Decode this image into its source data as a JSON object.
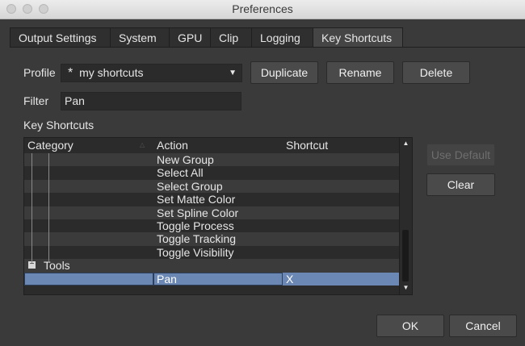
{
  "window": {
    "title": "Preferences"
  },
  "tabs": [
    {
      "label": "Output Settings"
    },
    {
      "label": "System"
    },
    {
      "label": "GPU"
    },
    {
      "label": "Clip"
    },
    {
      "label": "Logging"
    },
    {
      "label": "Key Shortcuts",
      "active": true
    }
  ],
  "profile": {
    "label": "Profile",
    "star": "*",
    "value": "my shortcuts",
    "buttons": {
      "duplicate": "Duplicate",
      "rename": "Rename",
      "delete": "Delete"
    }
  },
  "filter": {
    "label": "Filter",
    "value": "Pan"
  },
  "shortcuts": {
    "section_label": "Key Shortcuts",
    "columns": {
      "category": "Category",
      "action": "Action",
      "shortcut": "Shortcut"
    },
    "rows": [
      {
        "category": "",
        "action": "New Group",
        "shortcut": ""
      },
      {
        "category": "",
        "action": "Select All",
        "shortcut": ""
      },
      {
        "category": "",
        "action": "Select Group",
        "shortcut": ""
      },
      {
        "category": "",
        "action": "Set Matte Color",
        "shortcut": ""
      },
      {
        "category": "",
        "action": "Set Spline Color",
        "shortcut": ""
      },
      {
        "category": "",
        "action": "Toggle Process",
        "shortcut": ""
      },
      {
        "category": "",
        "action": "Toggle Tracking",
        "shortcut": ""
      },
      {
        "category": "",
        "action": "Toggle Visibility",
        "shortcut": ""
      },
      {
        "category": "Tools",
        "action": "",
        "shortcut": ""
      },
      {
        "category": "",
        "action": "Pan",
        "shortcut": "X"
      }
    ],
    "side_buttons": {
      "use_default": "Use Default",
      "clear": "Clear"
    }
  },
  "footer": {
    "ok": "OK",
    "cancel": "Cancel"
  },
  "colors": {
    "background": "#3a3a3a",
    "selection": "#6b87b4",
    "field": "#2b2b2b"
  },
  "icons": {
    "sort": "sort-ascending-icon",
    "collapse": "minus-icon",
    "dropdown": "chevron-down-icon"
  }
}
